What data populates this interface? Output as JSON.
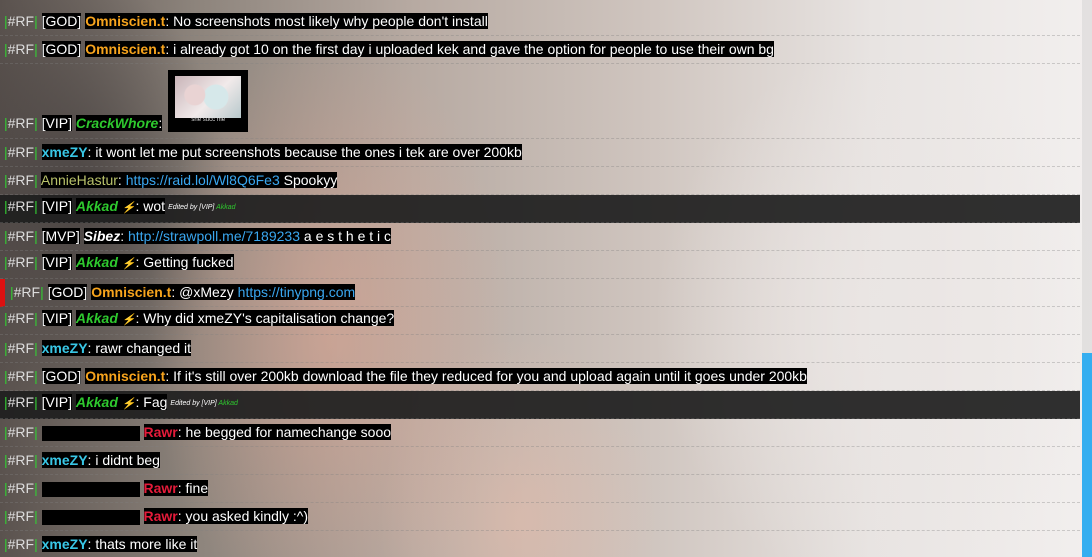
{
  "channel_tag": "#RF",
  "scrollbar": {
    "position_fraction": 0.63,
    "thumb_color": "#35aef0"
  },
  "colors": {
    "god_name": "#f7a41d",
    "user_cyan": "#39c7e6",
    "vip_green": "#2ec82e",
    "red_name": "#e51b3a",
    "link": "#3aa7f0",
    "mention_bar": "#dd1111"
  },
  "messages": [
    {
      "rank": "[GOD]",
      "user": "Omniscien.t",
      "text": ": No screenshots most likely why people don't install"
    },
    {
      "rank": "[GOD]",
      "user": "Omniscien.t",
      "text": ": i already got 10 on the first day i uploaded kek and gave the option for people to use their own bg"
    },
    {
      "rank": "[VIP]",
      "user": "CrackWhore",
      "text": ":",
      "image_caption": "she succ me"
    },
    {
      "user": "xmeZY",
      "text": ": it wont let me put screenshots because the ones i tek are over 200kb"
    },
    {
      "user": "AnnieHastur",
      "sep": ": ",
      "link": "https://raid.lol/Wl8Q6Fe3",
      "text": " Spookyy"
    },
    {
      "rank": "[VIP]",
      "user": "Akkad",
      "icon": "bolt-icon",
      "text": ": wot",
      "edited_by": "Edited by [VIP]",
      "edited_user": "Akkad"
    },
    {
      "rank": "[MVP]",
      "user": "Sibez",
      "sep": ": ",
      "link": "http://strawpoll.me/7189233",
      "text": " a e s t h e t i c"
    },
    {
      "rank": "[VIP]",
      "user": "Akkad",
      "icon": "bolt-icon",
      "text": ": Getting fucked"
    },
    {
      "rank": "[GOD]",
      "user": "Omniscien.t",
      "text": ": @xMezy ",
      "link": "https://tinypng.com"
    },
    {
      "rank": "[VIP]",
      "user": "Akkad",
      "icon": "bolt-icon",
      "text": ": Why did xmeZY's capitalisation change?"
    },
    {
      "user": "xmeZY",
      "text": ": rawr changed it"
    },
    {
      "rank": "[GOD]",
      "user": "Omniscien.t",
      "text": ": If it's still over 200kb download the file they reduced for you and upload again until it goes under 200kb"
    },
    {
      "rank": "[VIP]",
      "user": "Akkad",
      "icon": "bolt-icon",
      "text": ": Fag",
      "edited_by": "Edited by [VIP]",
      "edited_user": "Akkad"
    },
    {
      "user": "Rawr",
      "text": ": he begged for namechange sooo"
    },
    {
      "user": "xmeZY",
      "text": ": i didnt beg"
    },
    {
      "user": "Rawr",
      "text": ": fine"
    },
    {
      "user": "Rawr",
      "text": ": you asked kindly :^)"
    },
    {
      "user": "xmeZY",
      "text": ": thats more like it"
    }
  ]
}
